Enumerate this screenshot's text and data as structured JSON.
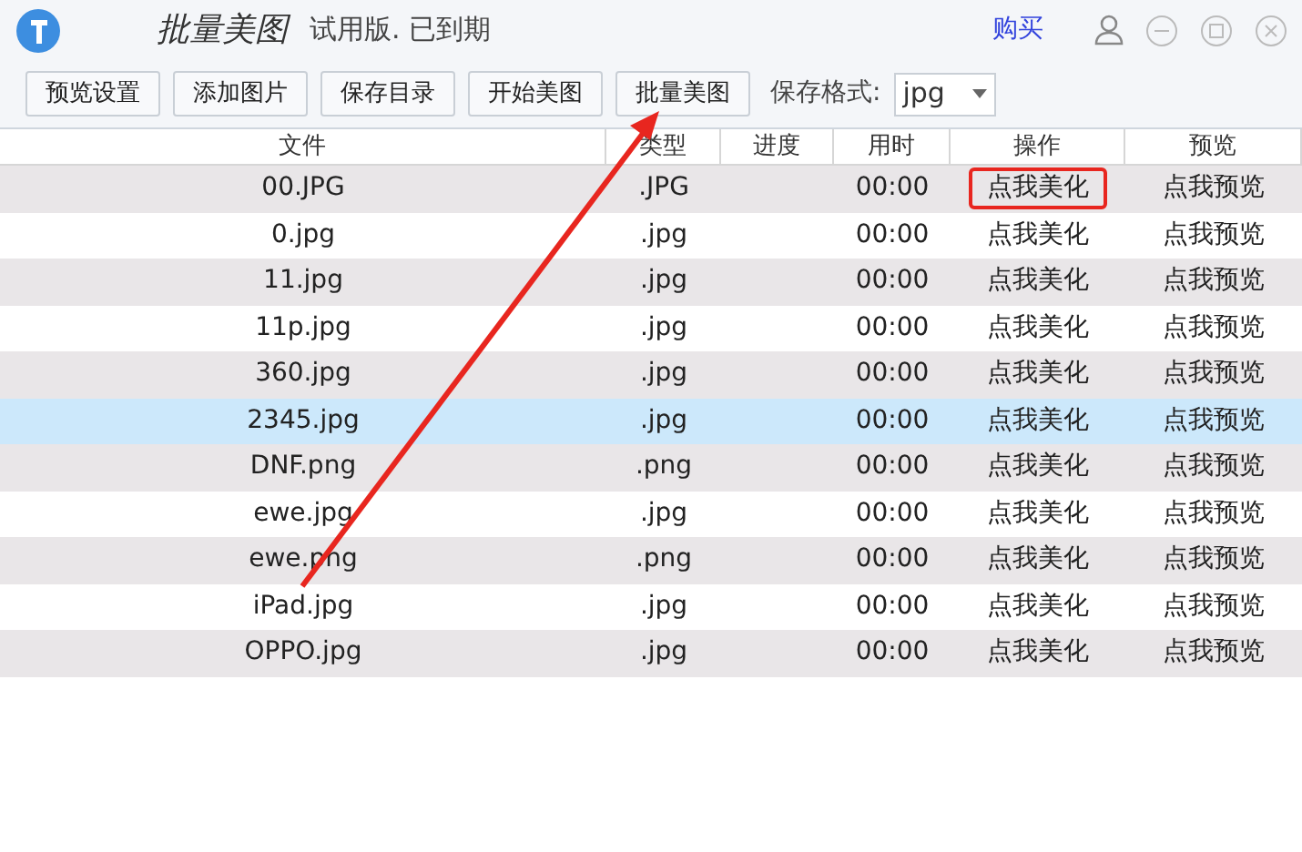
{
  "window": {
    "title": "批量美图",
    "license": "试用版. 已到期",
    "buy_link": "购买"
  },
  "toolbar": {
    "buttons": [
      {
        "label": "预览设置"
      },
      {
        "label": "添加图片"
      },
      {
        "label": "保存目录"
      },
      {
        "label": "开始美图"
      },
      {
        "label": "批量美图"
      }
    ],
    "format_label": "保存格式:",
    "format_value": "jpg"
  },
  "table": {
    "columns": [
      "文件",
      "类型",
      "进度",
      "用时",
      "操作",
      "预览"
    ],
    "rows": [
      {
        "file": "00.JPG",
        "type": ".JPG",
        "time": "00:00",
        "action": "点我美化",
        "preview": "点我预览",
        "selected": false,
        "highlighted": true
      },
      {
        "file": "0.jpg",
        "type": ".jpg",
        "time": "00:00",
        "action": "点我美化",
        "preview": "点我预览",
        "selected": false,
        "highlighted": false
      },
      {
        "file": "11.jpg",
        "type": ".jpg",
        "time": "00:00",
        "action": "点我美化",
        "preview": "点我预览",
        "selected": false,
        "highlighted": false
      },
      {
        "file": "11p.jpg",
        "type": ".jpg",
        "time": "00:00",
        "action": "点我美化",
        "preview": "点我预览",
        "selected": false,
        "highlighted": false
      },
      {
        "file": "360.jpg",
        "type": ".jpg",
        "time": "00:00",
        "action": "点我美化",
        "preview": "点我预览",
        "selected": false,
        "highlighted": false
      },
      {
        "file": "2345.jpg",
        "type": ".jpg",
        "time": "00:00",
        "action": "点我美化",
        "preview": "点我预览",
        "selected": true,
        "highlighted": false
      },
      {
        "file": "DNF.png",
        "type": ".png",
        "time": "00:00",
        "action": "点我美化",
        "preview": "点我预览",
        "selected": false,
        "highlighted": false
      },
      {
        "file": "ewe.jpg",
        "type": ".jpg",
        "time": "00:00",
        "action": "点我美化",
        "preview": "点我预览",
        "selected": false,
        "highlighted": false
      },
      {
        "file": "ewe.png",
        "type": ".png",
        "time": "00:00",
        "action": "点我美化",
        "preview": "点我预览",
        "selected": false,
        "highlighted": false
      },
      {
        "file": "iPad.jpg",
        "type": ".jpg",
        "time": "00:00",
        "action": "点我美化",
        "preview": "点我预览",
        "selected": false,
        "highlighted": false
      },
      {
        "file": "OPPO.jpg",
        "type": ".jpg",
        "time": "00:00",
        "action": "点我美化",
        "preview": "点我预览",
        "selected": false,
        "highlighted": false
      }
    ]
  }
}
